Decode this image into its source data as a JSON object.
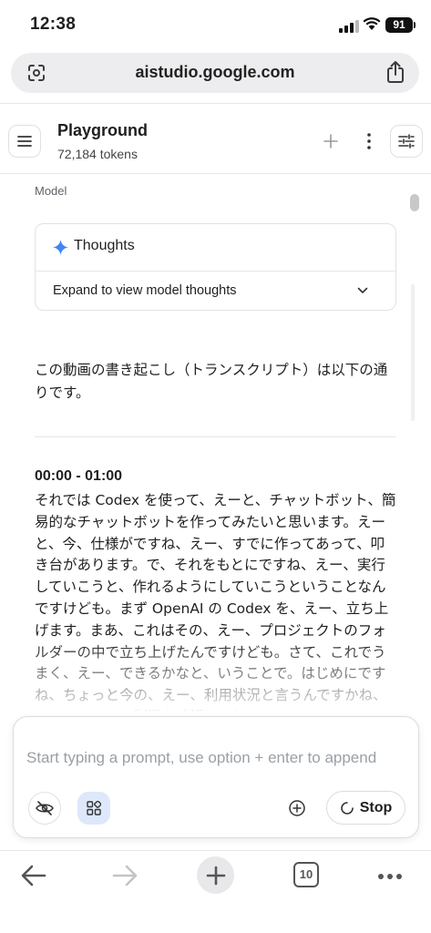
{
  "status_bar": {
    "time": "12:38",
    "battery": "91",
    "icons": [
      "signal-icon",
      "wifi-icon",
      "battery-icon"
    ]
  },
  "browser": {
    "url": "aistudio.google.com",
    "left_icon": "site-settings-icon",
    "right_icon": "share-icon"
  },
  "header": {
    "title": "Playground",
    "tokens": "72,184 tokens",
    "icons": [
      "menu-icon",
      "plus-icon",
      "more-vert-icon",
      "tune-icon"
    ]
  },
  "chat": {
    "role_label": "Model",
    "thoughts": {
      "title": "Thoughts",
      "expand_label": "Expand to view model thoughts"
    },
    "intro": "この動画の書き起こし（トランスクリプト）は以下の通りです。",
    "section": {
      "timestamp": "00:00 - 01:00",
      "transcript": "それでは Codex を使って、えーと、チャットボット、簡易的なチャットボットを作ってみたいと思います。えーと、今、仕様がですね、えー、すでに作ってあって、叩き台があります。で、それをもとにですね、えー、実行していこうと、作れるようにしていこうということなんですけども。まず OpenAI の Codex を、えー、立ち上げます。まあ、これはその、えー、プロジェクトのフォルダーの中で立ち上げたんですけども。さて、これでうまく、えー、できるかなと、いうことで。はじめにですね、ちょっと今の、えー、利用状況と言うんですかね、こうリミット、制限を確認してお"
    }
  },
  "prompt": {
    "placeholder": "Start typing a prompt, use option + enter to append",
    "stop_label": "Stop",
    "icons": [
      "visibility-off-icon",
      "apps-icon",
      "add-circle-icon",
      "spinner-icon"
    ]
  },
  "toolbar": {
    "tab_count": "10",
    "icons": [
      "back-arrow-icon",
      "forward-arrow-icon",
      "new-tab-icon",
      "tabs-icon",
      "more-icon"
    ]
  },
  "colors": {
    "accent_blue": "#4285f4",
    "selected_chip": "#dde8fb",
    "placeholder": "#9aa0a6"
  }
}
